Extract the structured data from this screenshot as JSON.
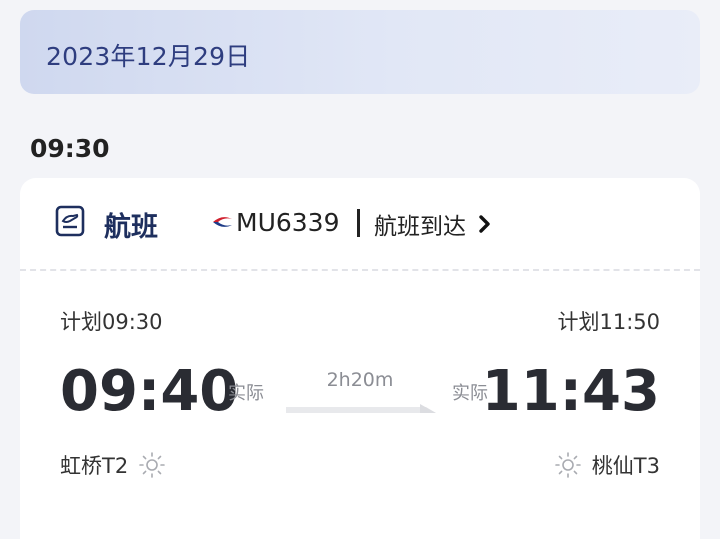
{
  "date_banner": {
    "text": "2023年12月29日"
  },
  "section_time": "09:30",
  "card": {
    "icon": "ticket-icon",
    "title": "航班",
    "airline_logo": "china-eastern-logo-icon",
    "flight_number": "MU6339",
    "status_link": "航班到达",
    "status_chevron": "chevron-right-icon",
    "departure": {
      "planned": "计划09:30",
      "actual_label": "实际",
      "actual_time": "09:40",
      "airport": "虹桥T2",
      "weather_icon": "sun-icon"
    },
    "duration": "2h20m",
    "arrival": {
      "planned": "计划11:50",
      "actual_label": "实际",
      "actual_time": "11:43",
      "airport": "桃仙T3",
      "weather_icon": "sun-icon"
    }
  },
  "colors": {
    "banner_text": "#2e3d7f",
    "title": "#1e2f5e",
    "airline_red": "#d0202e",
    "airline_blue": "#1f3c88",
    "muted": "#8b8d94"
  }
}
